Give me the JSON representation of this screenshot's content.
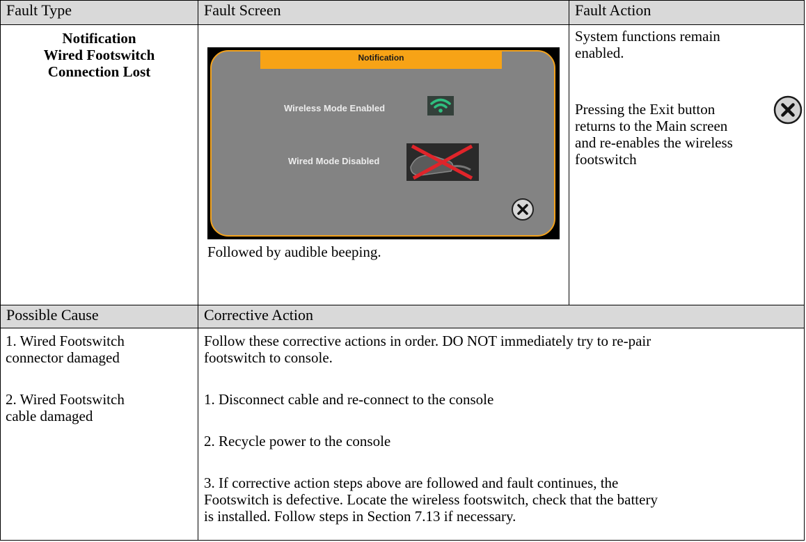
{
  "headers": {
    "fault_type": "Fault Type",
    "fault_screen": "Fault Screen",
    "fault_action": "Fault Action",
    "possible_cause": "Possible Cause",
    "corrective_action": "Corrective Action"
  },
  "fault_type_lines": [
    "Notification",
    "Wired Footswitch",
    "Connection Lost"
  ],
  "fault_screen": {
    "screen_title": "Notification",
    "wireless_label": "Wireless Mode Enabled",
    "wired_label": "Wired Mode Disabled",
    "caption": "Followed by audible beeping.",
    "wifi_icon_color": "#2fbf7f",
    "accent_color": "#f7a316"
  },
  "fault_action": {
    "line1": "System functions remain",
    "line2": "enabled.",
    "line3": "Pressing the Exit button",
    "line4": "returns to the Main screen",
    "line5": "and re-enables the wireless",
    "line6": "footswitch"
  },
  "possible_causes": [
    {
      "l1": "1. Wired Footswitch",
      "l2": "connector damaged"
    },
    {
      "l1": "2. Wired Footswitch",
      "l2": "cable damaged"
    }
  ],
  "corrective": {
    "intro1": "Follow these corrective actions in order. DO NOT immediately try to re-pair",
    "intro2": "footswitch to console.",
    "step1": "1. Disconnect cable and re-connect to the console",
    "step2": "2. Recycle power to the console",
    "step3_1": "3. If corrective action steps above are followed and fault continues, the",
    "step3_2": "Footswitch is defective. Locate the wireless footswitch, check that the battery",
    "step3_3": "is installed. Follow steps in Section 7.13 if necessary."
  }
}
